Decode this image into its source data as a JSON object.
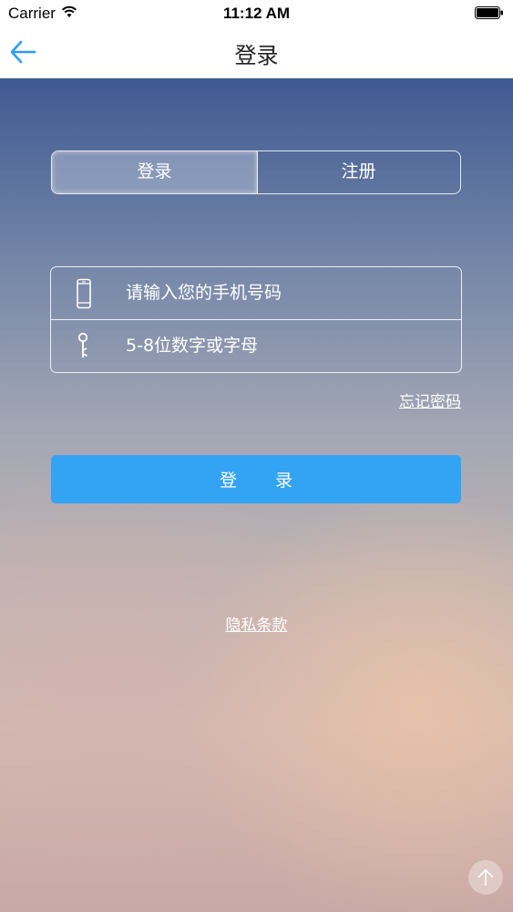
{
  "status_bar": {
    "carrier": "Carrier",
    "time": "11:12 AM"
  },
  "nav": {
    "title": "登录",
    "back_icon": "back-arrow-icon"
  },
  "segment": {
    "login_label": "登录",
    "register_label": "注册",
    "selected": "登录"
  },
  "form": {
    "phone_placeholder": "请输入您的手机号码",
    "password_placeholder": "5-8位数字或字母",
    "phone_icon": "phone-icon",
    "password_icon": "key-icon",
    "forgot_label": "忘记密码",
    "login_label": "登录"
  },
  "footer": {
    "privacy_label": "隐私条款"
  },
  "colors": {
    "accent": "#33a3f4",
    "back_arrow": "#2e9bf0"
  }
}
